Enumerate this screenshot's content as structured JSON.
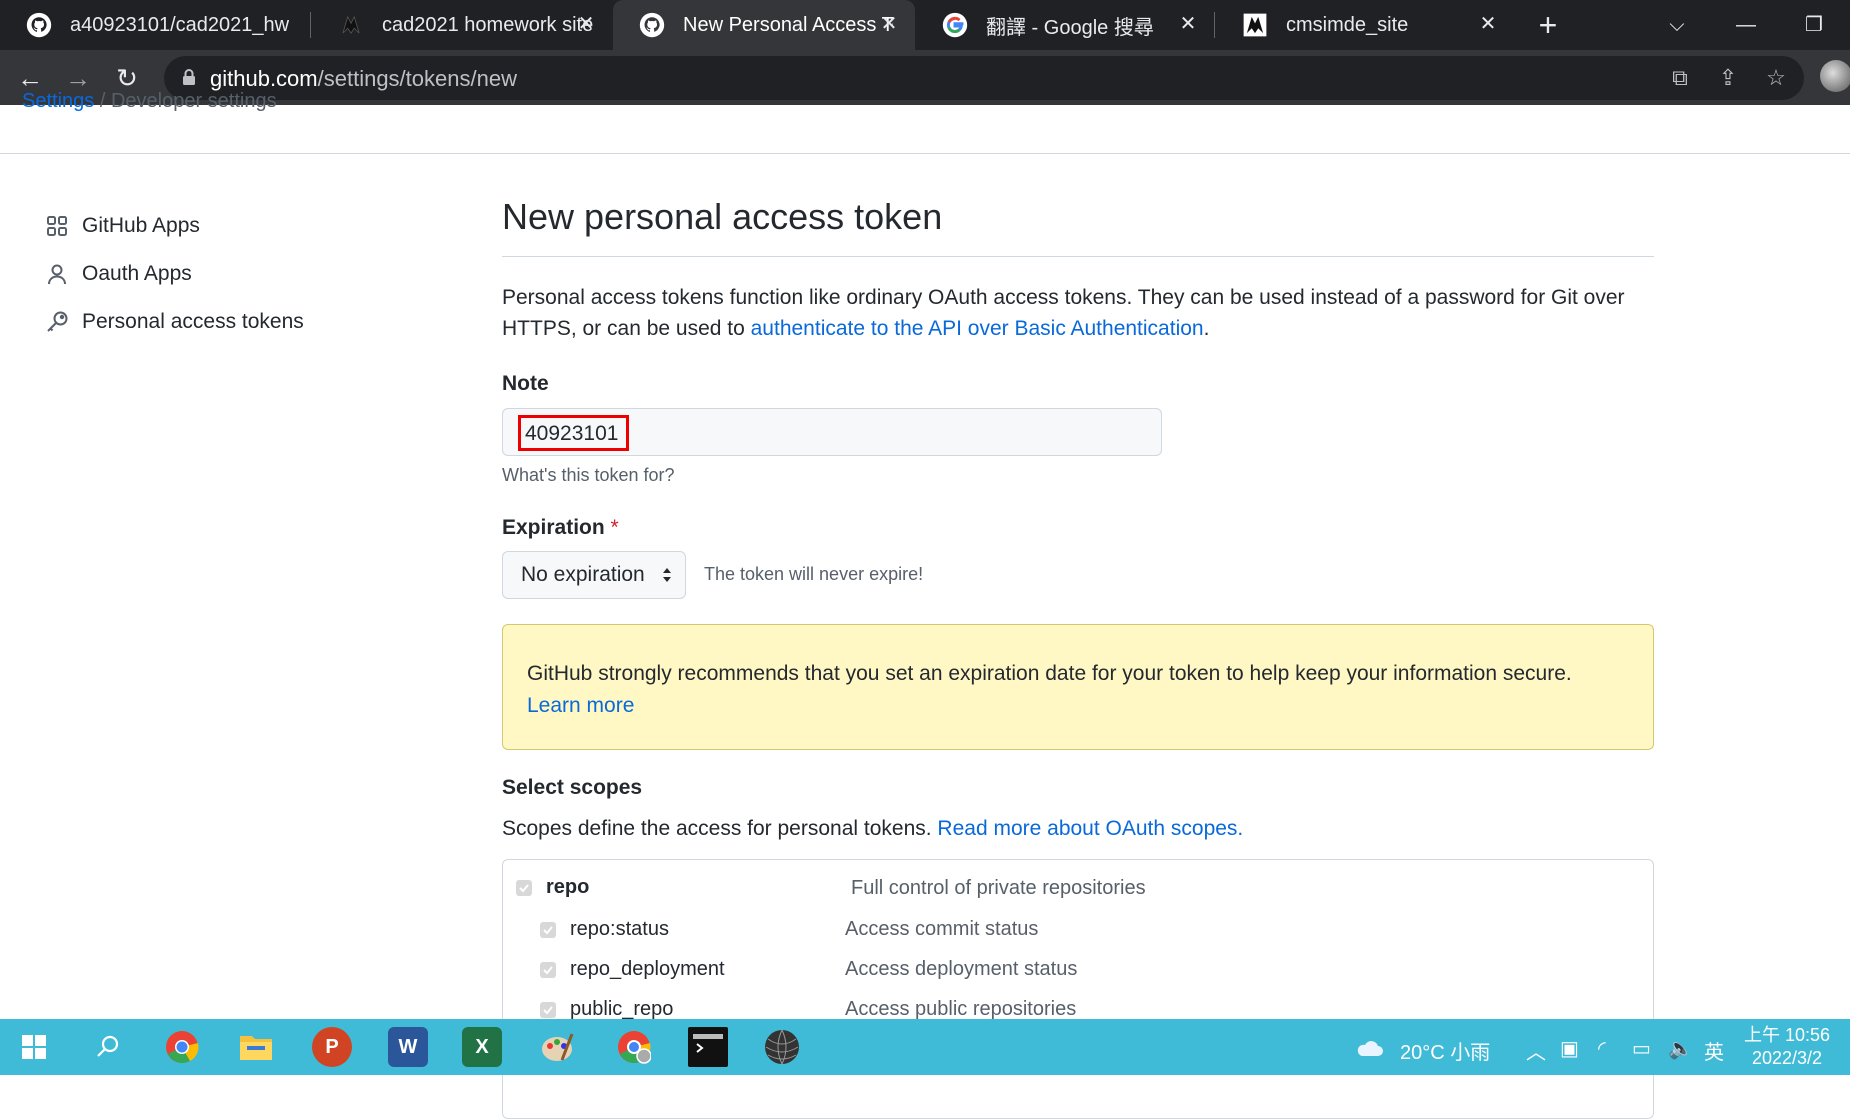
{
  "browser": {
    "tabs": [
      {
        "title": "a40923101/cad2021_hw",
        "favicon": "github-icon",
        "active": false
      },
      {
        "title": "cad2021 homework site",
        "favicon": "site-icon",
        "active": false
      },
      {
        "title": "New Personal Access To",
        "favicon": "github-icon",
        "active": true
      },
      {
        "title": "翻譯 - Google 搜尋",
        "favicon": "google-icon",
        "active": false
      },
      {
        "title": "cmsimde_site",
        "favicon": "site-icon",
        "active": false
      }
    ],
    "url_host": "github.com",
    "url_path": "/settings/tokens/new"
  },
  "breadcrumb": {
    "settings": "Settings",
    "separator": "/",
    "developer": "Developer settings"
  },
  "sidebar": {
    "items": [
      {
        "label": "GitHub Apps",
        "icon": "apps-icon"
      },
      {
        "label": "Oauth Apps",
        "icon": "person-icon"
      },
      {
        "label": "Personal access tokens",
        "icon": "key-icon"
      }
    ]
  },
  "main": {
    "title": "New personal access token",
    "intro_text": "Personal access tokens function like ordinary OAuth access tokens. They can be used instead of a password for Git over HTTPS, or can be used to ",
    "intro_link": "authenticate to the API over Basic Authentication",
    "intro_end": ".",
    "note_label": "Note",
    "note_value": "40923101",
    "note_help": "What's this token for?",
    "expiration_label": "Expiration",
    "expiration_required": "*",
    "expiration_value": "No expiration",
    "expiration_note": "The token will never expire!",
    "warning_text": "GitHub strongly recommends that you set an expiration date for your token to help keep your information secure.",
    "warning_link": "Learn more",
    "scopes_label": "Select scopes",
    "scopes_desc": "Scopes define the access for personal tokens. ",
    "scopes_link": "Read more about OAuth scopes.",
    "scopes": [
      {
        "name": "repo",
        "desc": "Full control of private repositories"
      },
      {
        "name": "repo:status",
        "desc": "Access commit status"
      },
      {
        "name": "repo_deployment",
        "desc": "Access deployment status"
      },
      {
        "name": "public_repo",
        "desc": "Access public repositories"
      }
    ]
  },
  "taskbar": {
    "weather": "20°C 小雨",
    "ime": "英",
    "time": "上午 10:56",
    "date": "2022/3/2",
    "colors": {
      "bar": "#3fbbd7"
    }
  }
}
